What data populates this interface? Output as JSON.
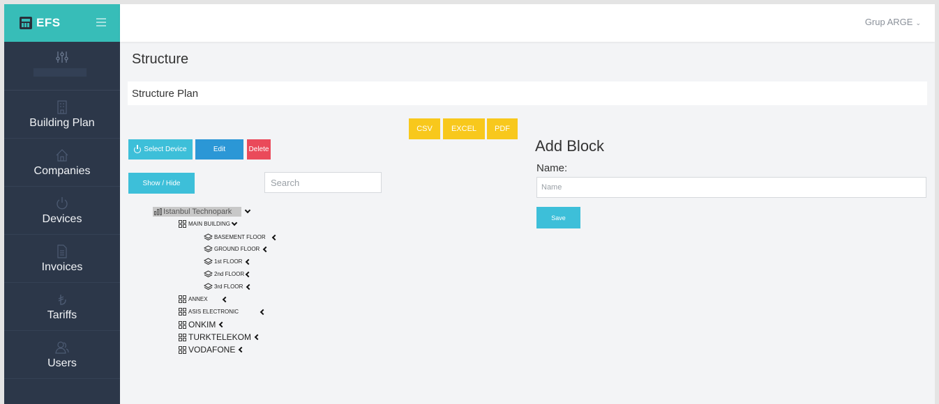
{
  "brand": {
    "title": "EFS"
  },
  "header": {
    "user": "Grup ARGE",
    "user_chevron": "⌄"
  },
  "sidebar": {
    "items": [
      {
        "label": "Building Plan",
        "icon": "building-icon"
      },
      {
        "label": "Companies",
        "icon": "home-icon"
      },
      {
        "label": "Devices",
        "icon": "power-icon"
      },
      {
        "label": "Invoices",
        "icon": "document-icon"
      },
      {
        "label": "Tariffs",
        "icon": "lira-icon"
      },
      {
        "label": "Users",
        "icon": "users-icon"
      }
    ]
  },
  "page": {
    "title": "Structure",
    "plan_title": "Structure Plan"
  },
  "export": {
    "csv": "CSV",
    "excel": "EXCEL",
    "pdf": "PDF"
  },
  "actions": {
    "select_device": "Select Device",
    "edit": "Edit",
    "delete": "Delete",
    "show_hide": "Show / Hide"
  },
  "search": {
    "placeholder": "Search",
    "value": ""
  },
  "tree": {
    "root": "Istanbul Technopark",
    "main_building": "MAIN BUILDING",
    "floors": [
      "BASEMENT FLOOR",
      "GROUND FLOOR",
      "1st FLOOR",
      "2nd FLOOR",
      "3rd FLOOR"
    ],
    "blocks_small": [
      "ANNEX",
      "ASIS ELECTRONIC"
    ],
    "blocks_large": [
      "ONKIM",
      "TURKTELEKOM",
      "VODAFONE"
    ]
  },
  "add_block": {
    "title": "Add Block",
    "name_label": "Name:",
    "name_placeholder": "Name",
    "name_value": "",
    "save": "Save"
  },
  "colors": {
    "brand": "#37bdb8",
    "sidebar": "#2c3749",
    "yellow": "#f8c81c",
    "cyan": "#3dbfd9",
    "blue": "#2b97d6",
    "red": "#ea4a5a"
  }
}
